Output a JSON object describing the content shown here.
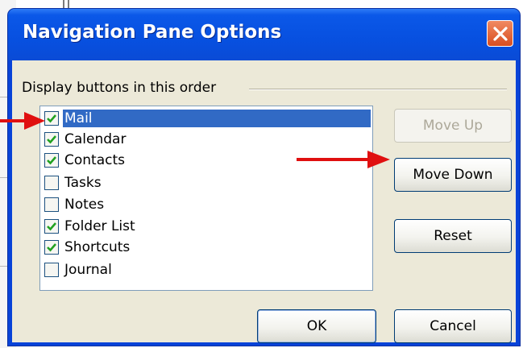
{
  "dialog": {
    "title": "Navigation Pane Options",
    "group_label": "Display buttons in this order"
  },
  "list": {
    "items": [
      {
        "label": "Mail",
        "checked": true,
        "selected": true
      },
      {
        "label": "Calendar",
        "checked": true,
        "selected": false
      },
      {
        "label": "Contacts",
        "checked": true,
        "selected": false
      },
      {
        "label": "Tasks",
        "checked": false,
        "selected": false
      },
      {
        "label": "Notes",
        "checked": false,
        "selected": false
      },
      {
        "label": "Folder List",
        "checked": true,
        "selected": false
      },
      {
        "label": "Shortcuts",
        "checked": true,
        "selected": false
      },
      {
        "label": "Journal",
        "checked": false,
        "selected": false
      }
    ]
  },
  "buttons": {
    "move_up": "Move Up",
    "move_down": "Move Down",
    "reset": "Reset",
    "ok": "OK",
    "cancel": "Cancel"
  },
  "colors": {
    "titlebar": "#0750e0",
    "selection": "#316ac5",
    "checkmark": "#21a121",
    "annotation_arrow": "#e01010"
  }
}
